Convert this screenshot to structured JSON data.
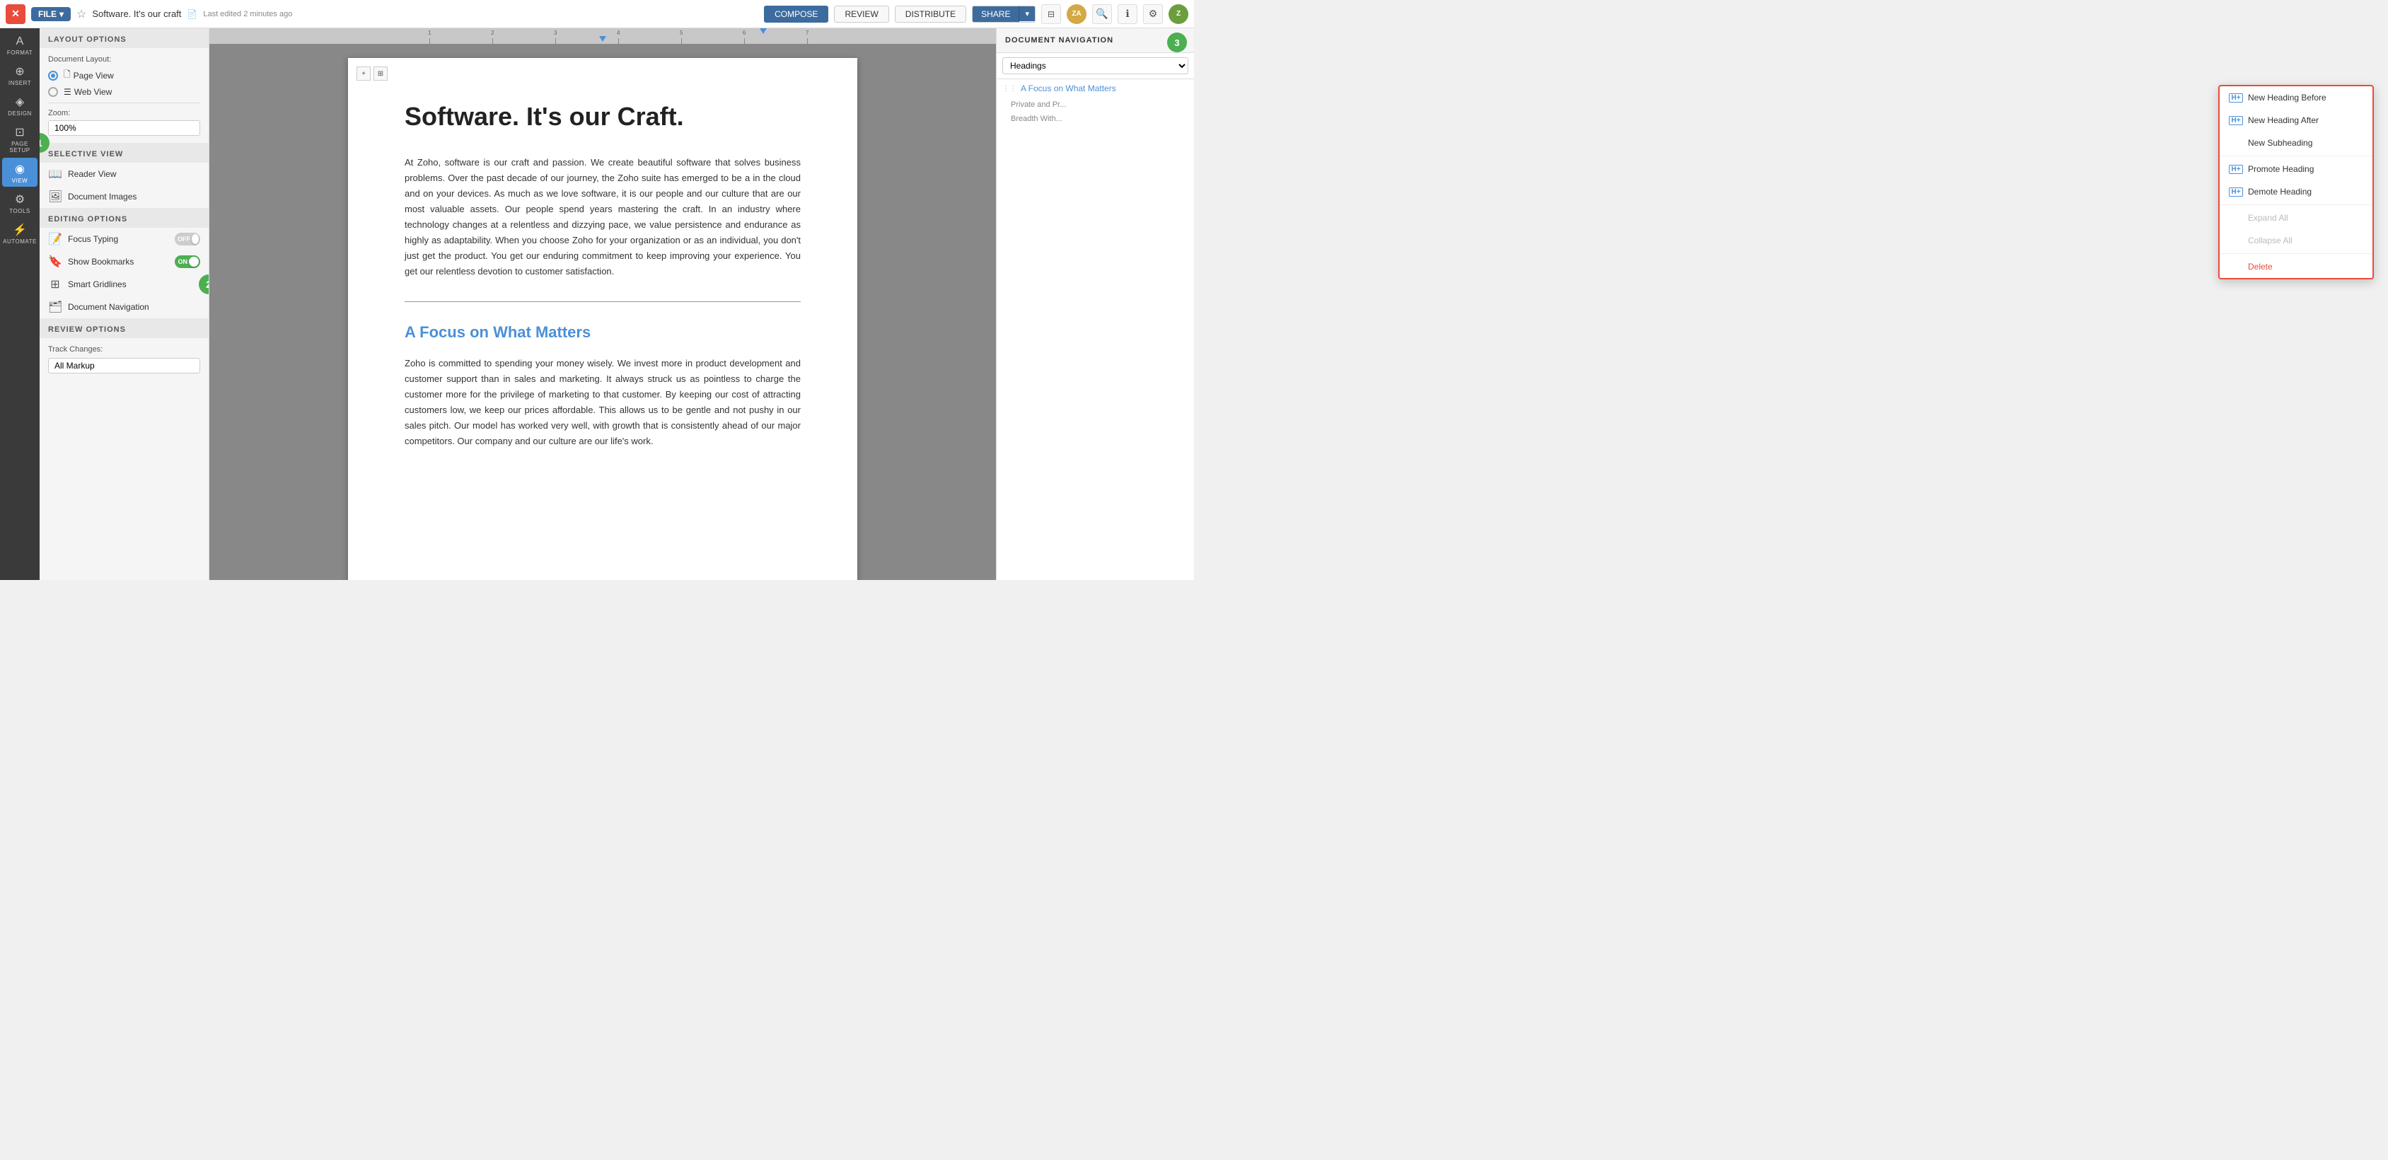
{
  "topbar": {
    "close_label": "✕",
    "file_label": "FILE",
    "file_arrow": "▾",
    "star_label": "☆",
    "title": "Software. It's our craft",
    "saved_label": "Last edited 2 minutes ago",
    "compose_label": "COMPOSE",
    "review_label": "REVIEW",
    "distribute_label": "DISTRIBUTE",
    "share_label": "SHARE",
    "share_arrow": "▾"
  },
  "icon_rail": {
    "items": [
      {
        "id": "format",
        "icon": "A",
        "label": "FORMAT"
      },
      {
        "id": "insert",
        "icon": "⊕",
        "label": "INSERT"
      },
      {
        "id": "design",
        "icon": "◈",
        "label": "DESIGN"
      },
      {
        "id": "page-setup",
        "icon": "⊡",
        "label": "PAGE SETUP"
      },
      {
        "id": "view",
        "icon": "◉",
        "label": "VIEW"
      },
      {
        "id": "tools",
        "icon": "⚙",
        "label": "TOOLS"
      },
      {
        "id": "automate",
        "icon": "⚡",
        "label": "AUTOMATE"
      }
    ]
  },
  "panel": {
    "layout_title": "LAYOUT OPTIONS",
    "doc_layout_label": "Document Layout:",
    "page_view_label": "Page View",
    "web_view_label": "Web View",
    "zoom_label": "Zoom:",
    "zoom_value": "100%",
    "selective_view_title": "SELECTIVE VIEW",
    "reader_view_label": "Reader View",
    "doc_images_label": "Document Images",
    "editing_title": "EDITING OPTIONS",
    "focus_typing_label": "Focus Typing",
    "focus_toggle": "OFF",
    "show_bookmarks_label": "Show Bookmarks",
    "show_bookmarks_toggle": "ON",
    "smart_gridlines_label": "Smart Gridlines",
    "doc_navigation_label": "Document Navigation",
    "review_title": "REVIEW OPTIONS",
    "track_label": "Track Changes:",
    "track_value": "All Markup"
  },
  "nav_panel": {
    "title": "DOCUMENT NAVIGATION",
    "filter": "Headings",
    "items": [
      {
        "text": "A Focus on What Matters",
        "level": 1
      },
      {
        "text": "Private and Pr...",
        "level": 2
      },
      {
        "text": "Breadth With...",
        "level": 2
      }
    ]
  },
  "context_menu": {
    "items": [
      {
        "id": "new-heading-before",
        "label": "New Heading Before",
        "icon": "H+",
        "type": "h-before"
      },
      {
        "id": "new-heading-after",
        "label": "New Heading After",
        "icon": "H+",
        "type": "h-after"
      },
      {
        "id": "new-subheading",
        "label": "New Subheading",
        "type": "none"
      },
      {
        "id": "promote-heading",
        "label": "Promote Heading",
        "icon": "H+",
        "type": "h"
      },
      {
        "id": "demote-heading",
        "label": "Demote Heading",
        "icon": "H+",
        "type": "h"
      },
      {
        "id": "expand-all",
        "label": "Expand All",
        "type": "disabled"
      },
      {
        "id": "collapse-all",
        "label": "Collapse All",
        "type": "disabled"
      },
      {
        "id": "delete",
        "label": "Delete",
        "type": "danger"
      }
    ]
  },
  "document": {
    "title": "Software. It's our Craft.",
    "para1": "At Zoho, software is our craft and passion. We create beautiful software that solves business problems. Over the past decade of our journey, the Zoho suite has emerged to be a in the cloud and on your devices. As much as we love software, it is our people and our culture that are our most valuable assets. Our people spend years mastering the craft. In an industry where technology changes at a relentless and dizzying pace, we value persistence and endurance as highly as adaptability. When you choose Zoho for your organization or as an individual, you don't just get the product. You get our enduring commitment to keep improving your experience. You get our relentless devotion to customer satisfaction.",
    "heading2": "A Focus on What Matters",
    "para2": "Zoho is committed to spending your money wisely. We invest more in product development and customer support than in sales and marketing. It always struck us as pointless to charge the customer more for the privilege of marketing to that customer. By keeping our cost of attracting customers low, we keep our prices affordable. This allows us to be gentle and not pushy in our sales pitch. Our model has worked very well, with growth that is consistently ahead of our major competitors. Our company and our culture are our life's work."
  }
}
